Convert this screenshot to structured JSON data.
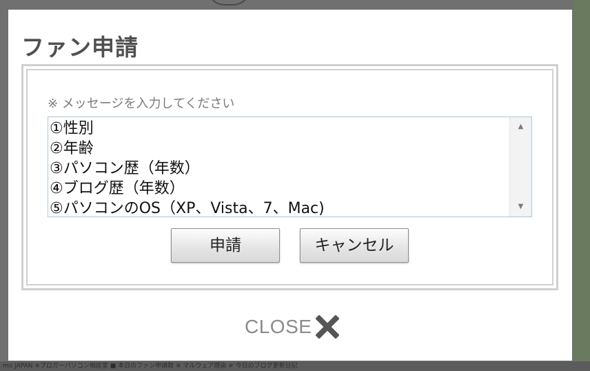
{
  "dialog": {
    "title": "ファン申請",
    "prompt": "※ メッセージを入力してください",
    "message_lines": [
      "①性別",
      "②年齢",
      "③パソコン歴（年数）",
      "④ブログ歴（年数）",
      "⑤パソコンのOS（XP、Vista、7、Mac)"
    ],
    "apply_label": "申請",
    "cancel_label": "キャンセル",
    "close_label": "CLOSE",
    "close_icon": "close-x-icon"
  },
  "background": {
    "footer_text": "mo JAPAN ※ブロガーパソコン相談室 ■ 本日のファン申請数 ※ マルウェア感染 ※ 今日のブログ更新日記"
  },
  "colors": {
    "overlay": "#707070",
    "title": "#505050",
    "frame_border": "#cfcfcf",
    "textarea_border": "#a9c7d6",
    "close_text": "#8a8a8a",
    "close_icon": "#555555"
  }
}
